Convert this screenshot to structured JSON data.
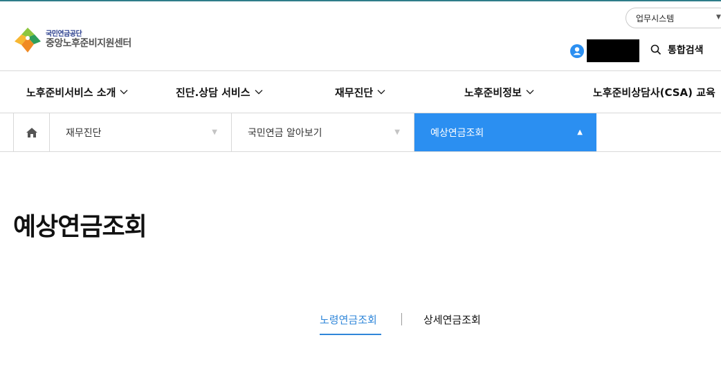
{
  "header": {
    "logo_sub": "국민연금공단",
    "logo_main": "중앙노후준비지원센터",
    "system_select": "업무시스템",
    "search_label": "통합검색"
  },
  "gnb": {
    "items": [
      {
        "label": "노후준비서비스 소개"
      },
      {
        "label": "진단.상담 서비스"
      },
      {
        "label": "재무진단"
      },
      {
        "label": "노후준비정보"
      },
      {
        "label": "노후준비상담사(CSA) 교육"
      }
    ]
  },
  "breadcrumb": {
    "items": [
      {
        "label": "재무진단"
      },
      {
        "label": "국민연금 알아보기"
      },
      {
        "label": "예상연금조회"
      }
    ]
  },
  "page": {
    "title": "예상연금조회"
  },
  "tabs": [
    {
      "label": "노령연금조회"
    },
    {
      "label": "상세연금조회"
    }
  ],
  "colors": {
    "accent_blue": "#2b8ff1",
    "tab_active": "#2f86d9",
    "logo_navy": "#2a3f8e"
  }
}
